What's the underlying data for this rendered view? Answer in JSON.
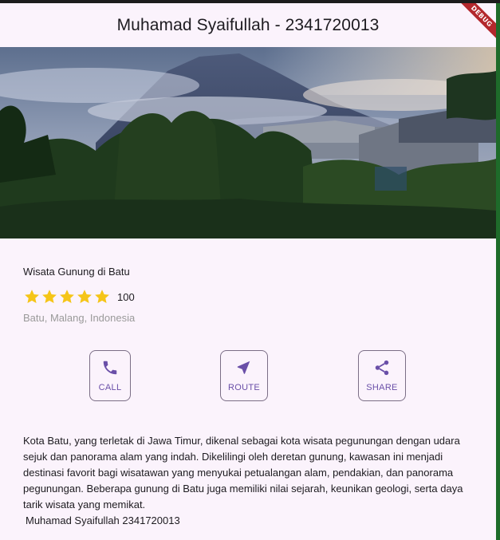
{
  "appbar": {
    "title": "Muhamad Syaifullah - 2341720013"
  },
  "debug_banner": "DEBUG",
  "place": {
    "title": "Wisata Gunung di Batu",
    "rating_stars": 5,
    "rating_count": "100",
    "location": "Batu, Malang, Indonesia"
  },
  "actions": [
    {
      "label": "CALL",
      "icon": "phone-icon"
    },
    {
      "label": "ROUTE",
      "icon": "navigation-arrow-icon"
    },
    {
      "label": "SHARE",
      "icon": "share-icon"
    }
  ],
  "description": "Kota Batu, yang terletak di Jawa Timur, dikenal sebagai kota wisata pegunungan dengan udara sejuk dan panorama alam yang indah. Dikelilingi oleh deretan gunung, kawasan ini menjadi destinasi favorit bagi wisatawan yang menyukai petualangan alam, pendakian, dan panorama pegunungan. Beberapa gunung di Batu juga memiliki nilai sejarah, keunikan geologi, serta daya tarik wisata yang memikat.",
  "author": "Muhamad Syaifullah 2341720013",
  "colors": {
    "background": "#fbf3fc",
    "accent": "#6a4fa8",
    "star": "#f5c518",
    "outline": "#7b6e86",
    "muted_text": "#9a9a9a"
  }
}
